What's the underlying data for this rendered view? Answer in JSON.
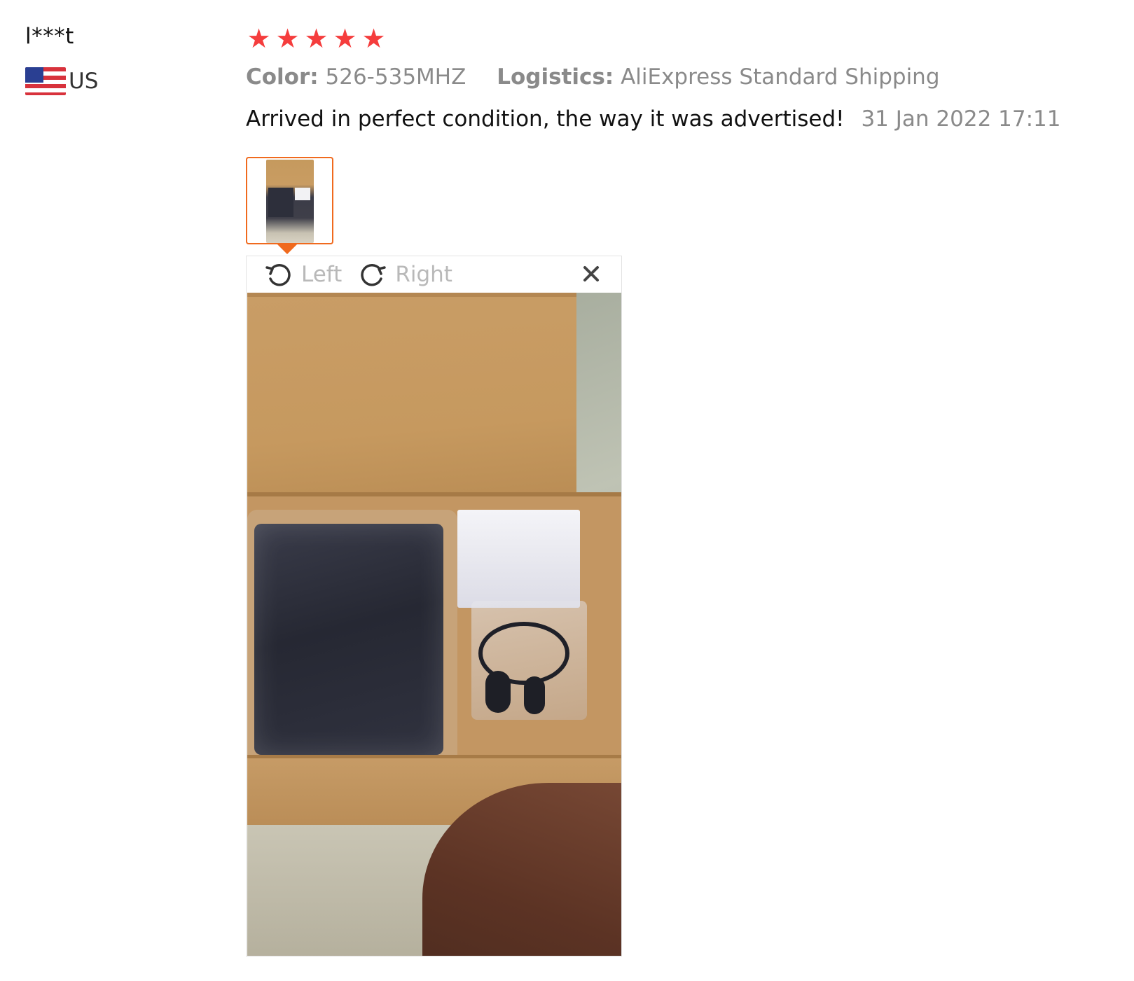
{
  "user": {
    "name": "l***t",
    "country": "US",
    "flag_icon": "us-flag-icon"
  },
  "review": {
    "rating": 5,
    "rating_max": 5,
    "color_label": "Color:",
    "color_value": "526-535MHZ",
    "logistics_label": "Logistics:",
    "logistics_value": "AliExpress Standard Shipping",
    "text": "Arrived in perfect condition, the way it was advertised!",
    "date": "31 Jan 2022 17:11",
    "photos_count": 1
  },
  "viewer": {
    "rotate_left_label": "Left",
    "rotate_right_label": "Right",
    "close_icon": "close-icon"
  },
  "colors": {
    "star": "#f53d3d",
    "thumb_border": "#f06a1e",
    "muted_text": "#8a8a8a",
    "toolbar_text": "#b9b9b9"
  }
}
